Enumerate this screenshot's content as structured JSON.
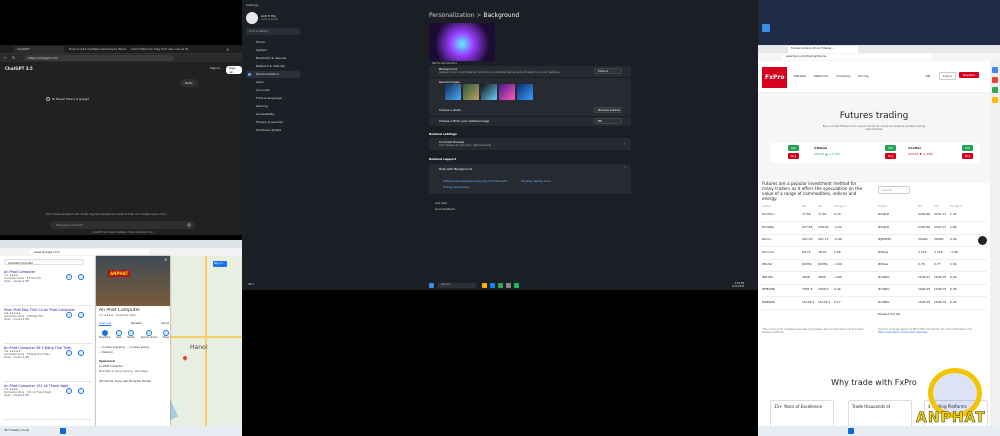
{
  "chatgpt": {
    "tabs": [
      "ChatGPT",
      "How to add multiple windows to Windows 11",
      "Cách thêm hai máy tính vào cửa sổ Win"
    ],
    "url": "https://chatgpt.com",
    "model": "ChatGPT 3.5",
    "login": "Sign in",
    "signup": "Sign up",
    "user_msg": "Hello",
    "bot_msg": "Hi there! How's it going?",
    "notice": "Don't share sensitive info. Chats may be reviewed and used to train our models.",
    "learn_more": "Learn more",
    "placeholder": "Message ChatGPT",
    "footer": "ChatGPT can make mistakes. Check important info."
  },
  "maps": {
    "url": "www.google.com",
    "query": "anphatcomputer",
    "results": [
      {
        "name": "An Phat Computer",
        "rating": "4.1",
        "addr": "Computer store · 49 Thái Hà",
        "meta": "Open · Closes 9 PM"
      },
      {
        "name": "Phan Phối Máy Tính Cũ An Phát Computer",
        "rating": "4.8",
        "addr": "Computer store · 158 Ngõ Tất",
        "meta": "Open · Closes 9 PM"
      },
      {
        "name": "An Phát Computer Số 5 Đặng Thái Thân",
        "rating": "4.9",
        "addr": "Computer store · 5 Đặng Thái Thân",
        "meta": "Open · Closes 9 PM"
      },
      {
        "name": "An Phat Computer 151 Lê Thanh Nghị",
        "rating": "4.5",
        "addr": "Computer store · 151 Lê Thanh Nghị",
        "meta": "Open · Closes 9 PM"
      }
    ],
    "actions": [
      "Website",
      "Directions"
    ],
    "detail": {
      "name": "An Phat Computer",
      "rating": "4.1",
      "category": "Computer store",
      "tabs": [
        "Overview",
        "Reviews",
        "About"
      ],
      "buttons": [
        "Directions",
        "Save",
        "Nearby",
        "Send to phone",
        "Share"
      ],
      "store": "In-store shopping",
      "pickup": "In-store pickup",
      "delivery": "Delivery",
      "sponsored": "Sponsored",
      "ad_title": "An Phat Computer",
      "ad_line": "Mua Máy Vi Dòng Gaming - Mua Ngay",
      "address": "49 Thái Hà, Trung Liệt, Đống Đa, Hà Nội"
    },
    "sign_text": "ANPHAT",
    "city": "Hanoi",
    "weather": "30°C Mostly cloudy",
    "signin": "Sign in"
  },
  "settings": {
    "window_title": "Settings",
    "user_name": "Anh Tr Pro",
    "user_sub": "Local Account",
    "search_placeholder": "Find a setting",
    "nav": [
      "Home",
      "System",
      "Bluetooth & devices",
      "Network & internet",
      "Personalization",
      "Apps",
      "Accounts",
      "Time & language",
      "Gaming",
      "Accessibility",
      "Privacy & security",
      "Windows Update"
    ],
    "selected_nav": "Personalization",
    "breadcrumb_parent": "Personalization",
    "breadcrumb_sep": ">",
    "breadcrumb_child": "Background",
    "preview_caption": "Set for all monitors",
    "bg_label": "Background",
    "bg_sub": "Applies to your current desktop. Solid color or slideshow backgrounds will apply to all your desktops.",
    "bg_value": "Picture",
    "recent": "Recent images",
    "choose_photo": "Choose a photo",
    "browse": "Browse photos",
    "fit_label": "Choose a fit for your desktop image",
    "fit_value": "Fill",
    "related": "Related settings",
    "contrast": "Contrast themes",
    "contrast_sub": "Color themes for low vision, light sensitivity",
    "support": "Related support",
    "help": "Help with Background",
    "help1": "Getting new wallpapers every day from Microsoft",
    "help2": "Showing desktop icons",
    "help3": "Finding new themes",
    "gethelp": "Get help",
    "feedback": "Give feedback"
  },
  "taskbar": {
    "search": "Search",
    "weather": "30°C",
    "time": "4:59 PM",
    "date": "6/11/2024"
  },
  "fxpro": {
    "url": "www.fxpro.com/trading/futures",
    "tab": "Futures trading: All our Futures ...",
    "logo": "FxPro",
    "menu": [
      "Markets",
      "Platforms",
      "Company",
      "Pricing"
    ],
    "lang": "EN",
    "login": "Log in",
    "register": "Register",
    "title": "Futures trading",
    "subtitle": "Buy and Sell Futures from around the world online and explore endless trading opportunities",
    "tickers": [
      {
        "sym": "#Wheat",
        "val": "563.25",
        "chg": "+1.72%"
      },
      {
        "sym": "#Coffee",
        "val": "229.95",
        "chg": "-1.28%"
      }
    ],
    "buy": "Buy",
    "sell": "Sell",
    "desc": "Futures are a popular investment method for many traders as it offers the speculation on the value of a range of commodities, indices and energy.",
    "search": "Search",
    "cols": [
      "Symbol",
      "Bid",
      "Ask",
      "Change %"
    ],
    "rows_left": [
      {
        "s": "#Cotton",
        "b": "77.56",
        "a": "77.61",
        "c": "0.74"
      },
      {
        "s": "#Coffee",
        "b": "227.55",
        "a": "228.00",
        "c": "-1.32"
      },
      {
        "s": "#Corn",
        "b": "391.00",
        "a": "391.75",
        "c": "-0.96"
      },
      {
        "s": "#Cocoa",
        "b": "84.75",
        "a": "78.20",
        "c": "1.56"
      },
      {
        "s": "#SUGI",
        "b": "60330",
        "a": "60350",
        "c": "-1.60"
      },
      {
        "s": "#EURX",
        "b": "4838",
        "a": "4839",
        "c": "-1.60"
      },
      {
        "s": "#FBUND",
        "b": "7581.5",
        "a": "7609.3",
        "c": "0.42"
      },
      {
        "s": "#ZERDE",
        "b": "15125.9",
        "a": "15133.3",
        "c": "0.17"
      }
    ],
    "rows_right": [
      {
        "s": "#GOLD",
        "b": "2290.80",
        "a": "2291.27",
        "c": "1.41"
      },
      {
        "s": "#GOLD",
        "b": "2303.82",
        "a": "2303.77",
        "c": "1.84"
      },
      {
        "s": "#JPN225",
        "b": "39440",
        "a": "39465",
        "c": "0.94"
      },
      {
        "s": "#NGas",
        "b": "2.713",
        "a": "2.719",
        "c": "-1.46"
      },
      {
        "s": "#NGas",
        "b": "2.76",
        "a": "2.77",
        "c": "1.56"
      },
      {
        "s": "#USBon",
        "b": "1099.11",
        "a": "1096.75",
        "c": "0.42"
      },
      {
        "s": "#USBon",
        "b": "1099.25",
        "a": "1096.75",
        "c": "0.45"
      },
      {
        "s": "#USBon",
        "b": "1095.25",
        "a": "1096.75",
        "c": "0.45"
      }
    ],
    "expand": "Expand full list",
    "note1": "*The pricing is for indicative purposes only. Please refer to individual product to start trading conditions",
    "note2": "Dynamic leverage applies to MT4, MT5 and cTrader. For more information visit",
    "note_link": "https://www.fxpro.com/dynamic-leverage",
    "why": "Why trade with FxPro",
    "cards": [
      "15+ Years of Excellence",
      "Trade thousands of",
      "4 Trading Platforms"
    ]
  },
  "watermark": {
    "brand": "ANPHAT"
  },
  "colors": {
    "accent": "#5ea0ef",
    "fxred": "#d6001c",
    "fxgreen": "#21a35a",
    "gptbg": "#212121"
  }
}
